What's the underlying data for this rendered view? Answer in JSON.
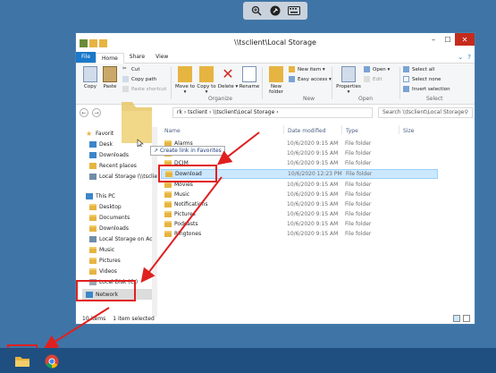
{
  "window": {
    "title": "\\\\tsclient\\Local Storage",
    "controls": [
      "–",
      "☐",
      "✕"
    ]
  },
  "ribbon": {
    "tabs": [
      "File",
      "Home",
      "Share",
      "View"
    ],
    "clipboard": {
      "copy": "Copy",
      "paste": "Paste",
      "cut": "Cut",
      "copy_path": "Copy path",
      "paste_shortcut": "Paste shortcut"
    },
    "organize": {
      "move_to": "Move to ▾",
      "copy_to": "Copy to ▾",
      "delete": "Delete ▾",
      "rename": "Rename",
      "label": "Organize"
    },
    "new": {
      "new_folder": "New folder",
      "new_item": "New item ▾",
      "easy_access": "Easy access ▾",
      "label": "New"
    },
    "open": {
      "properties": "Properties ▾",
      "open": "Open ▾",
      "edit": "Edit",
      "label": "Open"
    },
    "select": {
      "select_all": "Select all",
      "select_none": "Select none",
      "invert": "Invert selection",
      "label": "Select"
    }
  },
  "address": {
    "path": "rk › tsclient › \\\\tsclient\\Local Storage ›",
    "search_placeholder": "Search \\\\tsclient\\Local Storage"
  },
  "nav": {
    "favorites_label": "Favorit",
    "favorites": [
      "Desk",
      "Downloads",
      "Recent places",
      "Local Storage (\\\\tsclie"
    ],
    "this_pc_label": "This PC",
    "this_pc": [
      "Desktop",
      "Documents",
      "Downloads",
      "Local Storage on Ac",
      "Music",
      "Pictures",
      "Videos",
      "Local Disk (C:)"
    ],
    "network": "Network"
  },
  "columns": {
    "name": "Name",
    "date": "Date modified",
    "type": "Type",
    "size": "Size"
  },
  "files": [
    {
      "name": "Alarms",
      "date": "10/6/2020 9:15 AM",
      "type": "File folder"
    },
    {
      "name": "Android",
      "date": "10/6/2020 9:15 AM",
      "type": "File folder"
    },
    {
      "name": "DCIM",
      "date": "10/6/2020 9:15 AM",
      "type": "File folder"
    },
    {
      "name": "Download",
      "date": "10/6/2020 12:23 PM",
      "type": "File folder"
    },
    {
      "name": "Movies",
      "date": "10/6/2020 9:15 AM",
      "type": "File folder"
    },
    {
      "name": "Music",
      "date": "10/6/2020 9:15 AM",
      "type": "File folder"
    },
    {
      "name": "Notifications",
      "date": "10/6/2020 9:15 AM",
      "type": "File folder"
    },
    {
      "name": "Pictures",
      "date": "10/6/2020 9:15 AM",
      "type": "File folder"
    },
    {
      "name": "Podcasts",
      "date": "10/6/2020 9:15 AM",
      "type": "File folder"
    },
    {
      "name": "Ringtones",
      "date": "10/6/2020 9:15 AM",
      "type": "File folder"
    }
  ],
  "drag_tooltip": "Create link in Favorites",
  "status": {
    "items": "10 items",
    "selected": "1 item selected"
  },
  "colors": {
    "desktop": "#3f74a6",
    "highlight": "#e02020",
    "selection": "#cce8ff",
    "taskbar": "#1f4f80"
  },
  "icons": [
    "zoom-icon",
    "pin-icon",
    "keyboard-icon",
    "folder-icon",
    "chrome-icon"
  ]
}
